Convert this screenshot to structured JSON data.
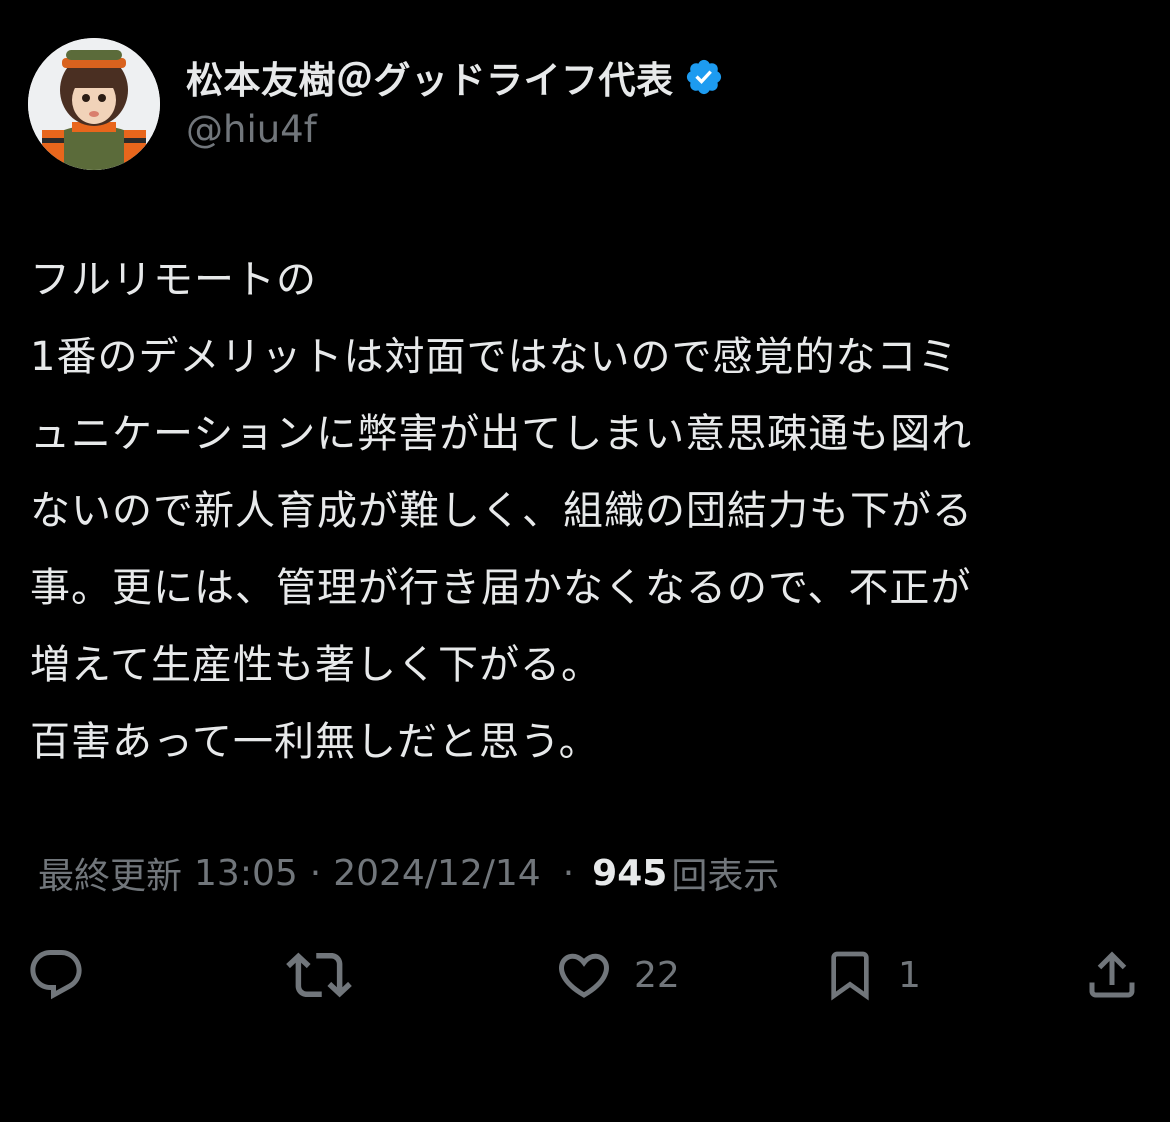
{
  "author": {
    "display_name": "松本友樹＠グッドライフ代表",
    "handle": "@hiu4f",
    "verified_icon": "verified-badge-icon",
    "verified_color": "#1d9bf0",
    "avatar_icon": "doll-avatar"
  },
  "tweet": {
    "lines": [
      "フルリモートの",
      "1番のデメリットは対面ではないので感覚的なコミ",
      "ュニケーションに弊害が出てしまい意思疎通も図れ",
      "ないので新人育成が難しく、組織の団結力も下がる",
      "事。更には、管理が行き届かなくなるので、不正が",
      "増えて生産性も著しく下がる。",
      "百害あって一利無しだと思う。"
    ]
  },
  "meta": {
    "prefix": "最終更新",
    "time": "13:05",
    "separator": "·",
    "date": "2024/12/14",
    "views_count": "945",
    "views_label": "回表示"
  },
  "actions": {
    "reply": {
      "icon": "reply-icon"
    },
    "retweet": {
      "icon": "retweet-icon"
    },
    "like": {
      "icon": "heart-icon",
      "count": "22"
    },
    "bookmark": {
      "icon": "bookmark-icon",
      "count": "1"
    },
    "share": {
      "icon": "share-icon"
    }
  },
  "colors": {
    "background": "#000000",
    "text_primary": "#e7e9ea",
    "text_secondary": "#71767b"
  }
}
